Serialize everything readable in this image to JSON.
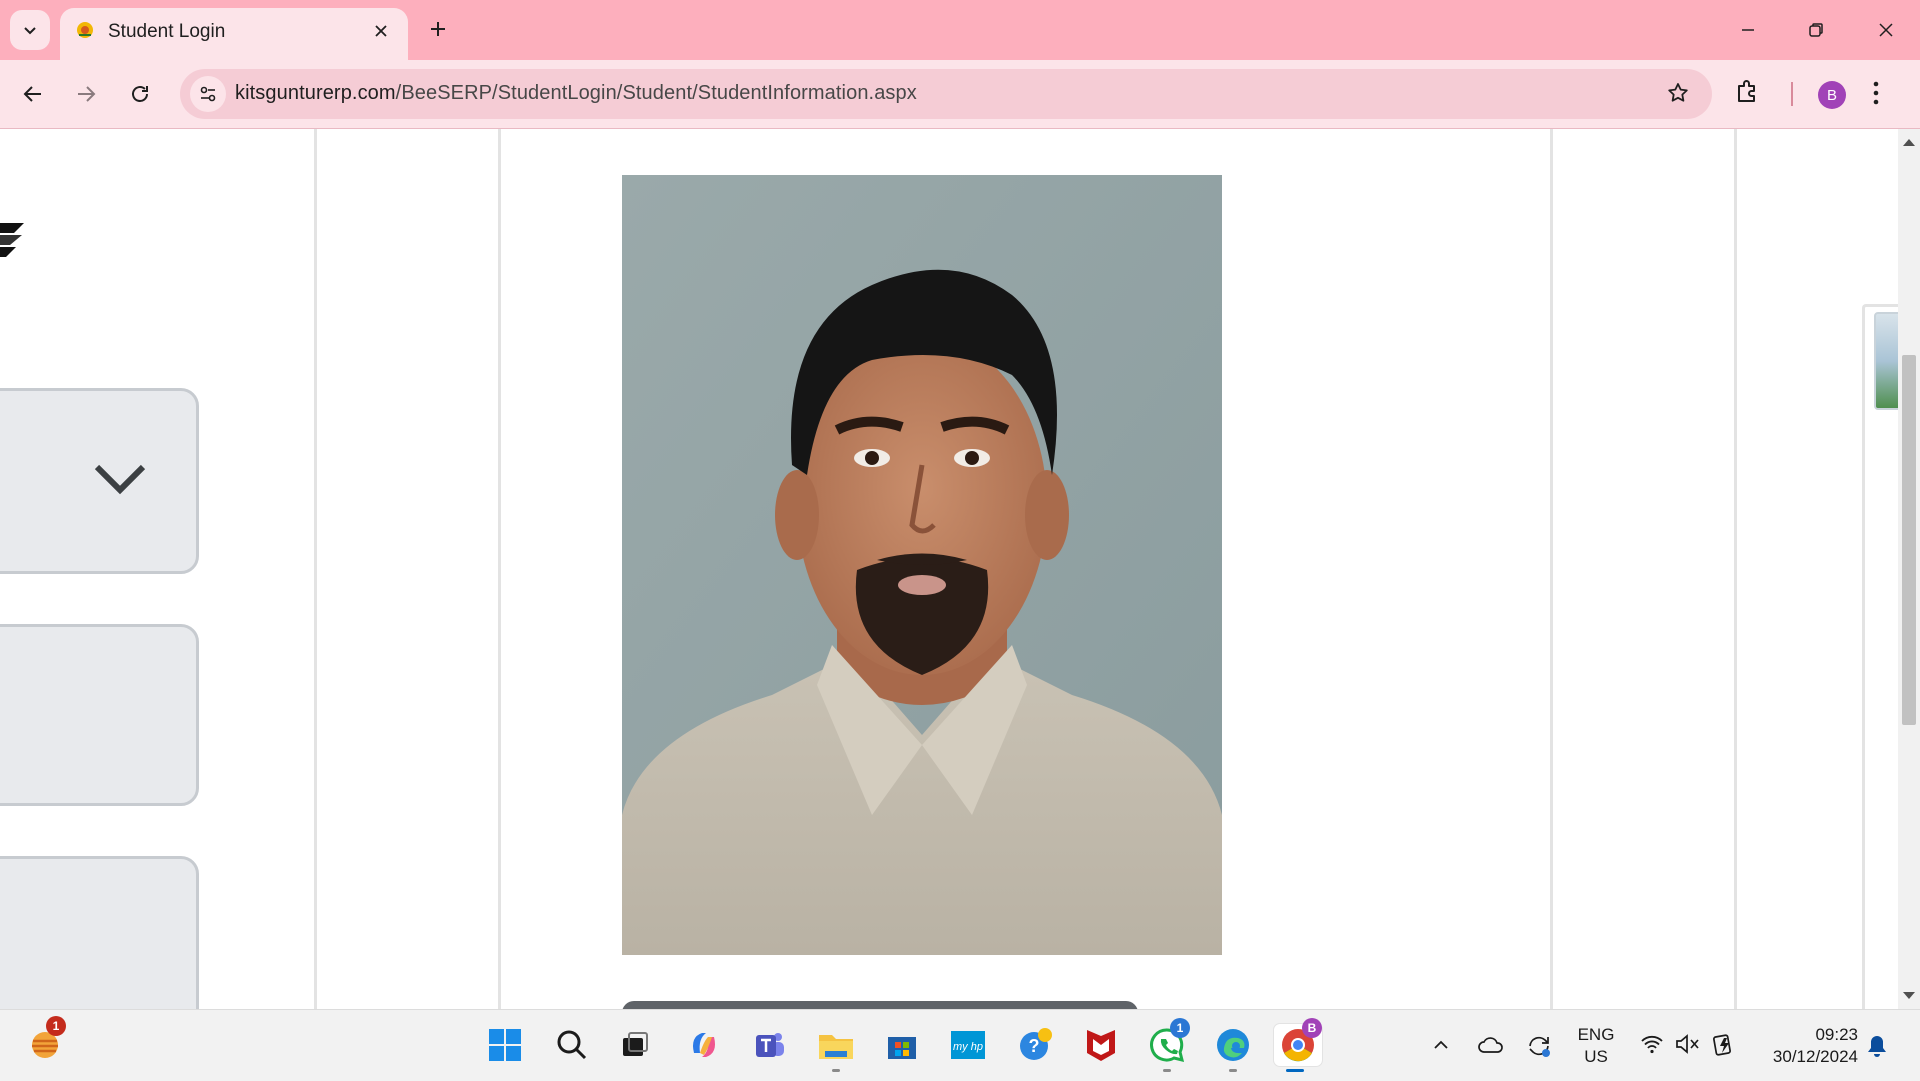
{
  "browser": {
    "tab_title": "Student Login",
    "url_host": "kitsgunturerp.com",
    "url_path": "/BeeSERP/StudentLogin/Student/StudentInformation.aspx",
    "profile_initial": "B",
    "accent_color": "#fdafbd"
  },
  "page": {
    "photo_alt": "Student photo"
  },
  "taskbar": {
    "weather_badge": "1",
    "whatsapp_badge": "1",
    "chrome_profile_badge": "B",
    "language_line1": "ENG",
    "language_line2": "US",
    "time": "09:23",
    "date": "30/12/2024"
  }
}
